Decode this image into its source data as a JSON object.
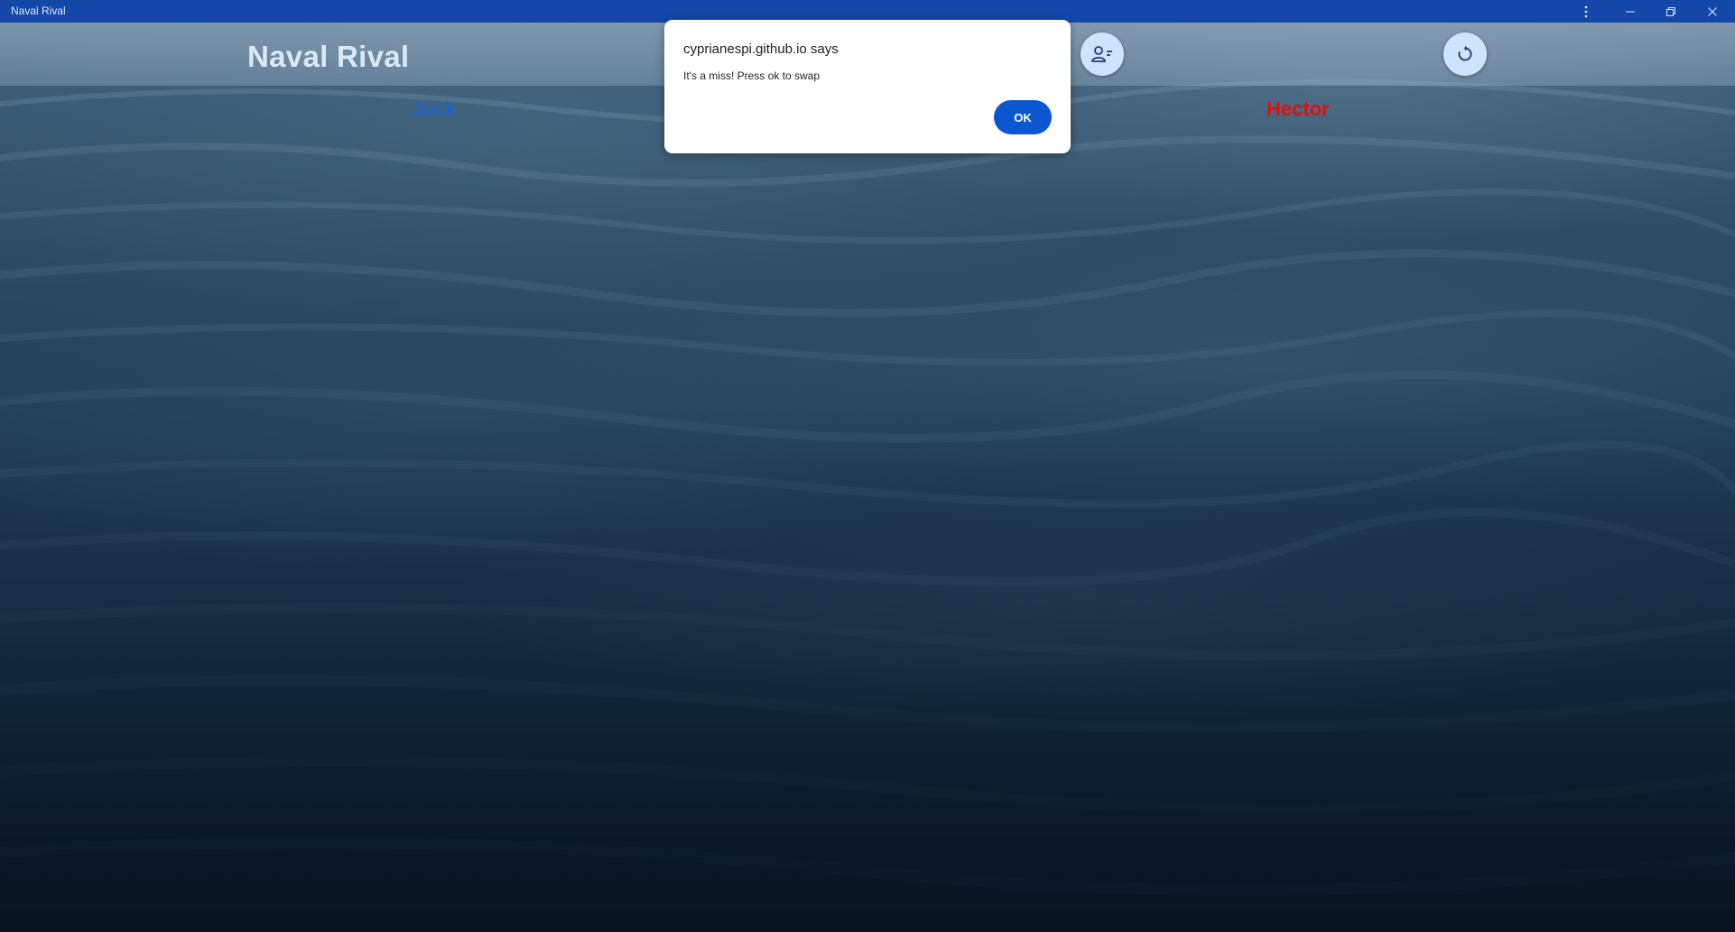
{
  "window": {
    "title": "Naval Rival",
    "controls": {
      "menu_icon": "kebab-menu-icon",
      "minimize_icon": "minimize-icon",
      "restore_icon": "restore-icon",
      "close_icon": "close-icon"
    }
  },
  "game": {
    "title": "Naval Rival",
    "buttons": {
      "players_icon": "user-edit-icon",
      "restart_icon": "restart-icon"
    },
    "players": {
      "left": {
        "name": "Jack",
        "color": "#1d63c4"
      },
      "right": {
        "name": "Hector",
        "color": "#e10e0e"
      }
    }
  },
  "dialog": {
    "title": "cyprianespi.github.io says",
    "message": "It's a miss! Press ok to swap",
    "ok_label": "OK"
  },
  "colors": {
    "titlebar": "#1348a9",
    "accent": "#0b57d0",
    "button_bg": "#cfe4fb"
  }
}
